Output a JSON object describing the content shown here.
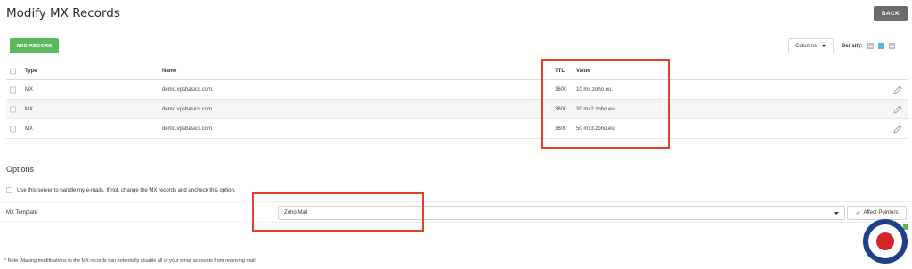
{
  "header": {
    "title": "Modify MX Records",
    "back_label": "BACK"
  },
  "toolbar": {
    "add_label": "ADD RECORD",
    "columns_label": "Columns",
    "density_label": "Density:"
  },
  "table": {
    "columns": {
      "type": "Type",
      "name": "Name",
      "ttl": "TTL",
      "value": "Value"
    },
    "rows": [
      {
        "type": "MX",
        "name": "demo.vpsbasics.com.",
        "ttl": "3600",
        "value": "10 mx.zoho.eu."
      },
      {
        "type": "MX",
        "name": "demo.vpsbasics.com.",
        "ttl": "3600",
        "value": "20 mx2.zoho.eu."
      },
      {
        "type": "MX",
        "name": "demo.vpsbasics.com.",
        "ttl": "3600",
        "value": "50 mx3.zoho.eu."
      }
    ]
  },
  "options": {
    "title": "Options",
    "use_server_label": "Use this server to handle my e-mails. If not, change the MX records and uncheck this option.",
    "mx_template_label": "MX Template",
    "mx_template_value": "Zoho Mail",
    "affect_pointers_label": "Affect Pointers"
  },
  "footer": {
    "note": "* Note: Making modifications to the MX records can potentially disable all of your email accounts from receiving mail."
  },
  "colors": {
    "accent_green": "#5cb85c",
    "back_button": "#6b6b6b",
    "highlight_red": "#e0412b",
    "density_active": "#5bb4e0"
  }
}
